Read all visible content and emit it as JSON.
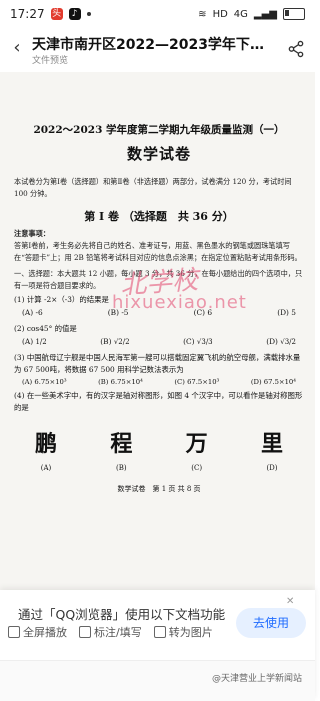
{
  "status_bar": {
    "time": "17:27",
    "network": "HD",
    "signal": "4G",
    "battery": "24",
    "battery_level": 0.24
  },
  "header": {
    "title": "天津市南开区2022—2023学年下学期...",
    "subtitle": "文件预览"
  },
  "document": {
    "title": "2022～2023 学年度第二学期九年级质量监测（一）",
    "subtitle": "数学试卷",
    "intro": "本试卷分为第Ⅰ卷（选择题）和第Ⅱ卷（非选择题）两部分，试卷满分 120 分，考试时间 100 分钟。",
    "section_title": "第 Ⅰ 卷 （选择题　共 36 分）",
    "notice_label": "注意事项：",
    "notice_text": "答第Ⅰ卷前，考生务必先将自己的姓名、准考证号，用蓝、黑色墨水的钢笔或圆珠笔填写在“答题卡”上；用 2B 铅笔将考试科目对应的信息点涂黑；在指定位置粘贴考试用条形码。",
    "mc_intro": "一、选择题：本大题共 12 小题，每小题 3 分，共 36 分，在每小题给出的四个选项中，只有一项是符合题目要求的。",
    "q1": "(1) 计算 -2×（-3）的结果是",
    "q1_opts": [
      "(A) -6",
      "(B) -5",
      "(C) 6",
      "(D) 5"
    ],
    "q2": "(2) cos45° 的值是",
    "q2_opts": [
      "(A)",
      "(B)",
      "(C)",
      "(D)"
    ],
    "q2_vals": [
      "1/2",
      "√2/2",
      "√3/3",
      "√3/2"
    ],
    "q3": "(3) 中国航母辽宁舰是中国人民海军第一艘可以搭载固定翼飞机的航空母舰，满载排水量为 67 500吨，将数据 67 500 用科学记数法表示为",
    "q3_opts": [
      "(A) 6.75×10³",
      "(B) 6.75×10⁴",
      "(C) 67.5×10³",
      "(D) 67.5×10⁴"
    ],
    "q4": "(4) 在一些美术字中，有的汉字是轴对称图形，如图 4 个汉字中，可以看作是轴对称图形的是",
    "q4_chars": [
      "鹏",
      "程",
      "万",
      "里"
    ],
    "q4_labels": [
      "(A)",
      "(B)",
      "(C)",
      "(D)"
    ],
    "footer": "数学试卷　第 1 页 共 8 页"
  },
  "watermark": {
    "cn": "北学校",
    "en": "hixuexiao.net"
  },
  "banner": {
    "message": "通过「QQ浏览器」使用以下文档功能",
    "actions": [
      "全屏播放",
      "标注/填写",
      "转为图片"
    ],
    "use_button": "去使用",
    "account": "@天津营业上学新闻站"
  }
}
